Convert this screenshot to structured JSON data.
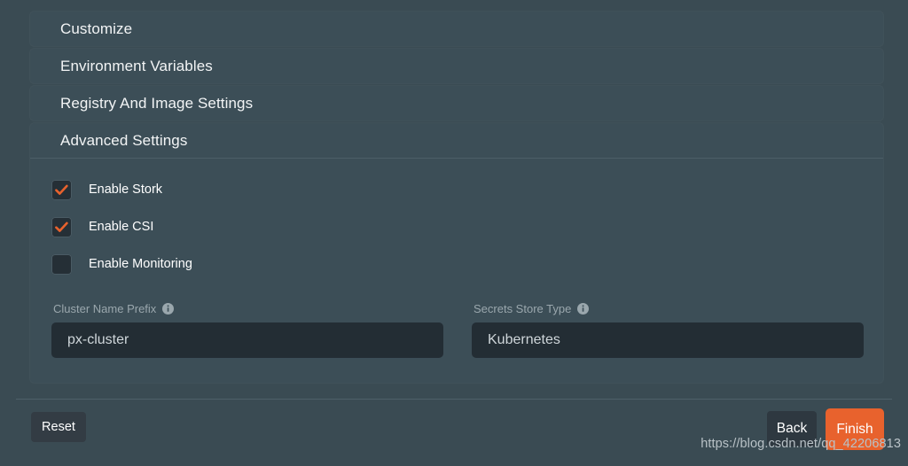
{
  "accordion": {
    "sections": [
      {
        "label": "Customize",
        "expanded": false
      },
      {
        "label": "Environment Variables",
        "expanded": false
      },
      {
        "label": "Registry And Image Settings",
        "expanded": false
      },
      {
        "label": "Advanced Settings",
        "expanded": true
      }
    ]
  },
  "advanced": {
    "checkboxes": [
      {
        "label": "Enable Stork",
        "checked": true
      },
      {
        "label": "Enable CSI",
        "checked": true
      },
      {
        "label": "Enable Monitoring",
        "checked": false
      }
    ],
    "fields": [
      {
        "label": "Cluster Name Prefix",
        "value": "px-cluster",
        "info_icon": "info-icon"
      },
      {
        "label": "Secrets Store Type",
        "value": "Kubernetes",
        "info_icon": "info-icon"
      }
    ]
  },
  "footer": {
    "reset_label": "Reset",
    "back_label": "Back",
    "finish_label": "Finish"
  },
  "watermark": "https://blog.csdn.net/qq_42206813",
  "colors": {
    "page_background": "#3a4b53",
    "panel_background": "#3c4e57",
    "input_background": "#232d34",
    "accent_orange": "#e8622d",
    "divider": "#4e6069",
    "label_text": "#9aa7ad"
  }
}
